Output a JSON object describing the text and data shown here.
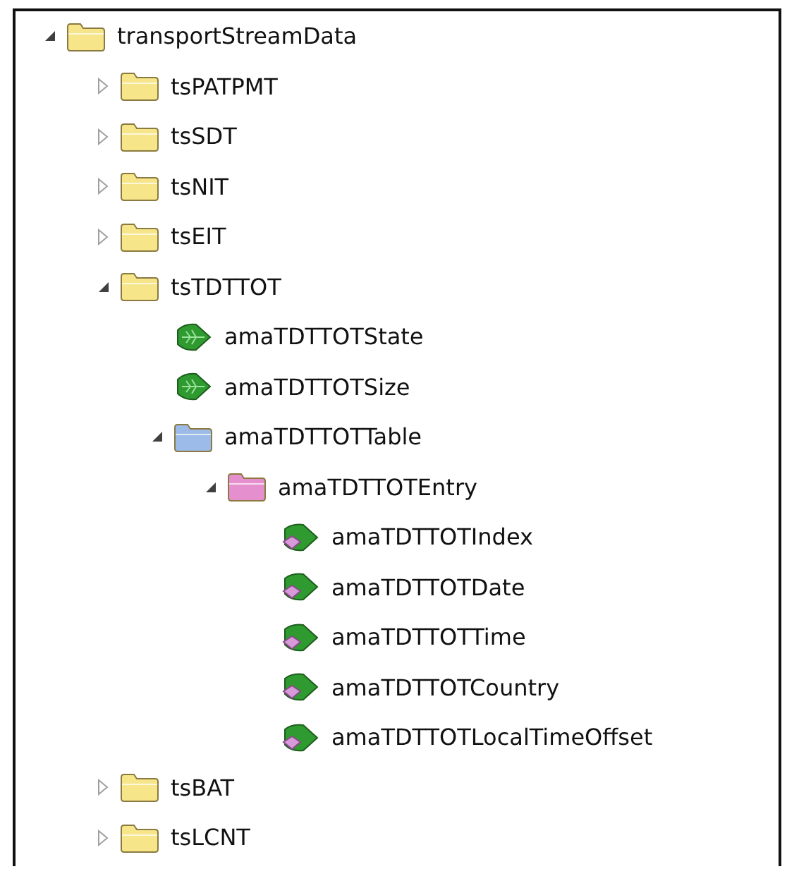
{
  "tree": [
    {
      "kind": "folder",
      "color": "#f7e58a",
      "label": "transportStreamData",
      "expanded": true,
      "children": [
        {
          "kind": "folder",
          "color": "#f7e58a",
          "label": "tsPATPMT",
          "expanded": false
        },
        {
          "kind": "folder",
          "color": "#f7e58a",
          "label": "tsSDT",
          "expanded": false
        },
        {
          "kind": "folder",
          "color": "#f7e58a",
          "label": "tsNIT",
          "expanded": false
        },
        {
          "kind": "folder",
          "color": "#f7e58a",
          "label": "tsEIT",
          "expanded": false
        },
        {
          "kind": "folder",
          "color": "#f7e58a",
          "label": "tsTDTTOT",
          "expanded": true,
          "children": [
            {
              "kind": "scalar",
              "label": "amaTDTTOTState"
            },
            {
              "kind": "scalar",
              "label": "amaTDTTOTSize"
            },
            {
              "kind": "folder",
              "color": "#9dbbe8",
              "label": "amaTDTTOTTable",
              "expanded": true,
              "children": [
                {
                  "kind": "folder",
                  "color": "#e58fcf",
                  "label": "amaTDTTOTEntry",
                  "expanded": true,
                  "children": [
                    {
                      "kind": "column",
                      "label": "amaTDTTOTIndex"
                    },
                    {
                      "kind": "column",
                      "label": "amaTDTTOTDate"
                    },
                    {
                      "kind": "column",
                      "label": "amaTDTTOTTime"
                    },
                    {
                      "kind": "column",
                      "label": "amaTDTTOTCountry"
                    },
                    {
                      "kind": "column",
                      "label": "amaTDTTOTLocalTimeOffset"
                    }
                  ]
                }
              ]
            }
          ]
        },
        {
          "kind": "folder",
          "color": "#f7e58a",
          "label": "tsBAT",
          "expanded": false
        },
        {
          "kind": "folder",
          "color": "#f7e58a",
          "label": "tsLCNT",
          "expanded": false
        }
      ]
    }
  ]
}
